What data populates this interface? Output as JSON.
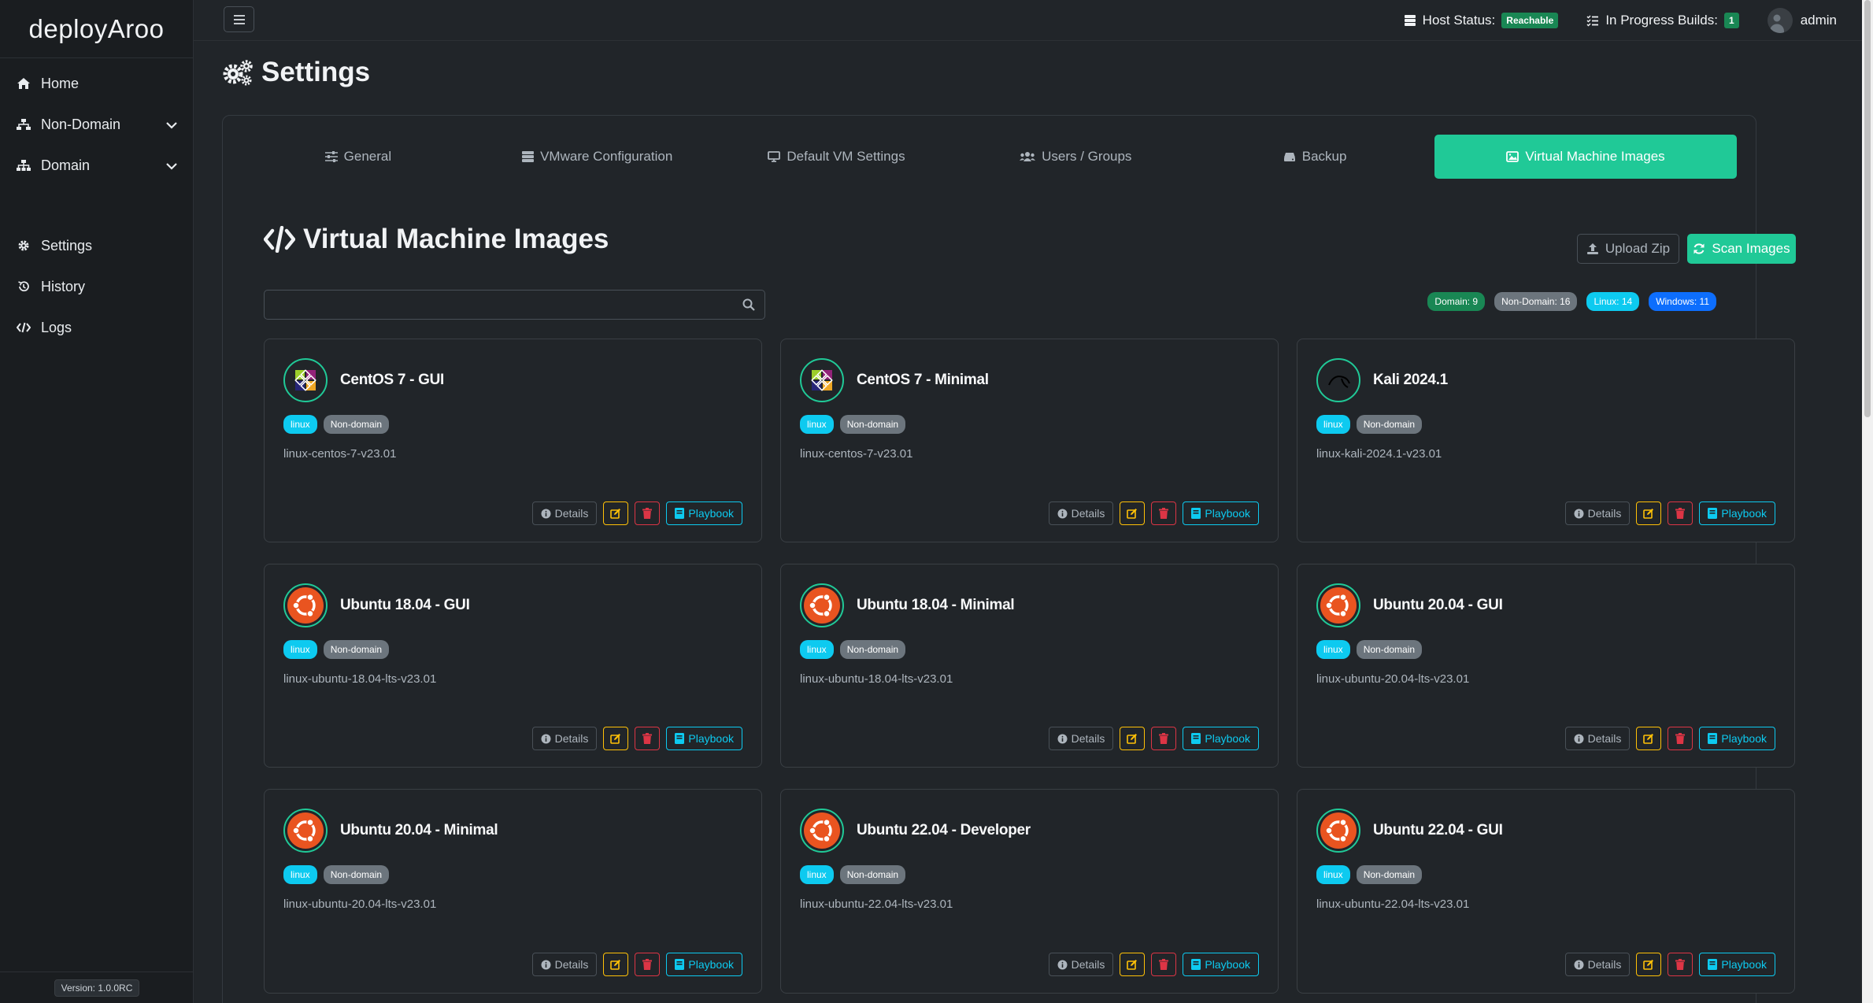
{
  "brand": "deployAroo",
  "version": "Version: 1.0.0RC",
  "nav": {
    "home": "Home",
    "non_domain": "Non-Domain",
    "domain": "Domain",
    "settings": "Settings",
    "history": "History",
    "logs": "Logs"
  },
  "topbar": {
    "host_status_label": "Host Status:",
    "host_status_value": "Reachable",
    "builds_label": "In Progress Builds:",
    "builds_value": "1",
    "user": "admin"
  },
  "page_title": "Settings",
  "tabs": [
    "General",
    "VMware Configuration",
    "Default VM Settings",
    "Users / Groups",
    "Backup",
    "Virtual Machine Images"
  ],
  "section": {
    "title": "Virtual Machine Images",
    "upload_label": "Upload Zip",
    "scan_label": "Scan Images",
    "search_value": "",
    "search_placeholder": ""
  },
  "counts": {
    "domain": "Domain: 9",
    "non_domain": "Non-Domain: 16",
    "linux": "Linux: 14",
    "windows": "Windows: 11"
  },
  "card_actions": {
    "details": "Details",
    "playbook": "Playbook"
  },
  "images": [
    {
      "title": "CentOS 7 - GUI",
      "os": "linux",
      "type": "Non-domain",
      "name": "linux-centos-7-v23.01",
      "logo": "centos-logo"
    },
    {
      "title": "CentOS 7 - Minimal",
      "os": "linux",
      "type": "Non-domain",
      "name": "linux-centos-7-v23.01",
      "logo": "centos-logo"
    },
    {
      "title": "Kali 2024.1",
      "os": "linux",
      "type": "Non-domain",
      "name": "linux-kali-2024.1-v23.01",
      "logo": "kali-logo"
    },
    {
      "title": "Ubuntu 18.04 - GUI",
      "os": "linux",
      "type": "Non-domain",
      "name": "linux-ubuntu-18.04-lts-v23.01",
      "logo": "ubuntu-logo"
    },
    {
      "title": "Ubuntu 18.04 - Minimal",
      "os": "linux",
      "type": "Non-domain",
      "name": "linux-ubuntu-18.04-lts-v23.01",
      "logo": "ubuntu-logo"
    },
    {
      "title": "Ubuntu 20.04 - GUI",
      "os": "linux",
      "type": "Non-domain",
      "name": "linux-ubuntu-20.04-lts-v23.01",
      "logo": "ubuntu-logo"
    },
    {
      "title": "Ubuntu 20.04 - Minimal",
      "os": "linux",
      "type": "Non-domain",
      "name": "linux-ubuntu-20.04-lts-v23.01",
      "logo": "ubuntu-logo"
    },
    {
      "title": "Ubuntu 22.04 - Developer",
      "os": "linux",
      "type": "Non-domain",
      "name": "linux-ubuntu-22.04-lts-v23.01",
      "logo": "ubuntu-logo"
    },
    {
      "title": "Ubuntu 22.04 - GUI",
      "os": "linux",
      "type": "Non-domain",
      "name": "linux-ubuntu-22.04-lts-v23.01",
      "logo": "ubuntu-logo"
    }
  ],
  "colors": {
    "accent": "#20c997",
    "success": "#198754",
    "info": "#0dcaf0",
    "primary": "#0d6efd",
    "warning": "#ffc107",
    "danger": "#dc3545",
    "secondary": "#6c757d"
  }
}
